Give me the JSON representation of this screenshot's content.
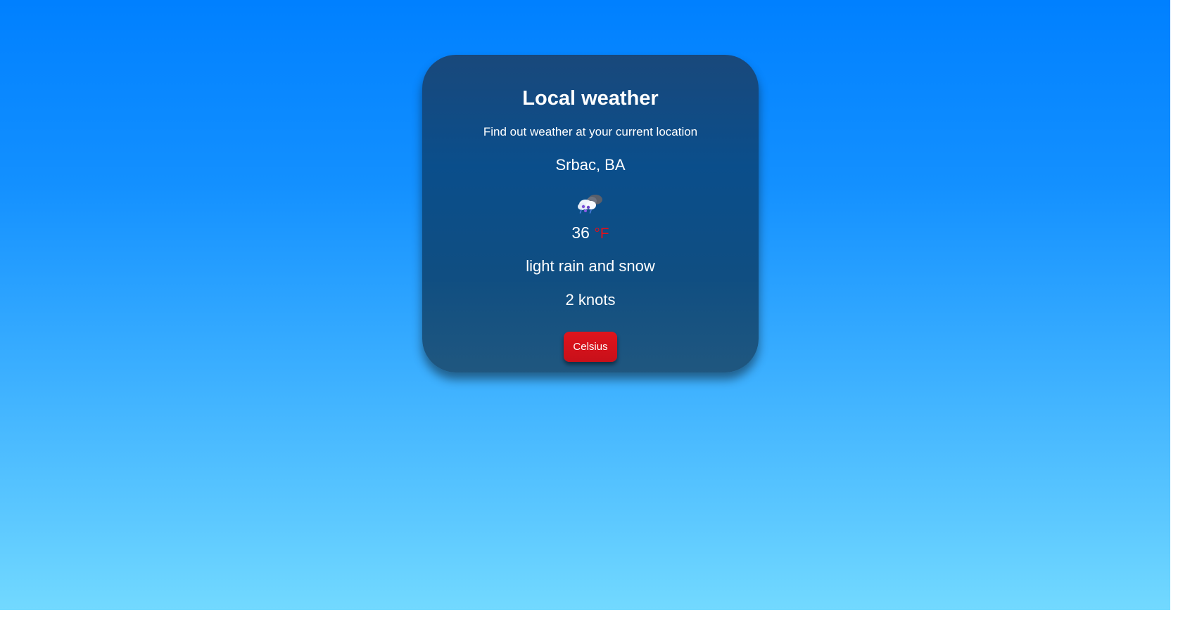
{
  "app": {
    "title": "Local weather",
    "subtitle": "Find out weather at your current location"
  },
  "weather": {
    "location": "Srbac, BA",
    "icon": "rain-snow-cloud-icon",
    "temperature": "36",
    "unit": "°F",
    "description": "light rain and snow",
    "wind": "2 knots"
  },
  "controls": {
    "unit_toggle_label": "Celsius"
  },
  "colors": {
    "background_top": "#0080ff",
    "background_bottom": "#72d9ff",
    "card": "#0e4a84",
    "unit_accent": "#e3101a",
    "button": "#d0121b"
  }
}
